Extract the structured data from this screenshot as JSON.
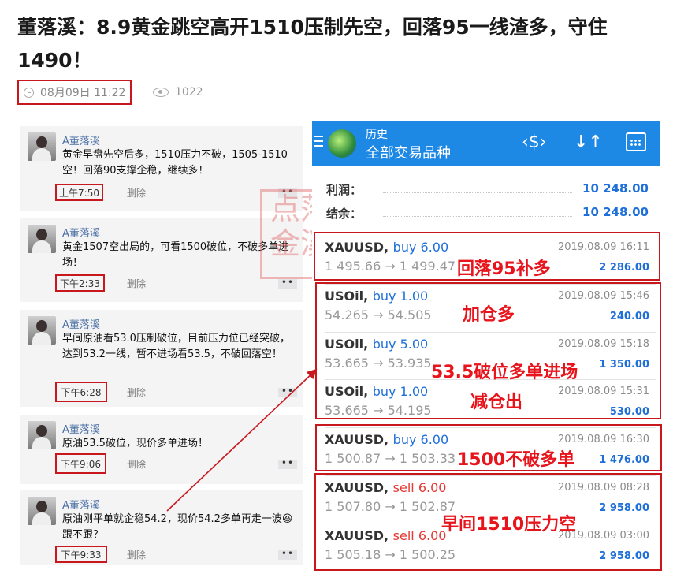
{
  "article": {
    "title": "董落溪：8.9黄金跳空高开1510压制先空，回落95一线渣多，守住1490！",
    "date": "08月09日 11:22",
    "views": "1022"
  },
  "chat": {
    "messages": [
      {
        "name": "A董落溪",
        "text": "黄金早盘先空后多，1510压力不破，1505-1510空！回落90支撑企稳，继续多！",
        "time": "上午7:50",
        "delete": "删除"
      },
      {
        "name": "A董落溪",
        "text": "黄金1507空出局的，可看1500破位，不破多单进场！",
        "time": "下午2:33",
        "delete": "删除"
      },
      {
        "name": "A董落溪",
        "text": "早间原油看53.0压制破位，目前压力位已经突破，达到53.2一线，暂不进场看53.5，不破回落空！",
        "time": "下午6:28",
        "delete": "删除"
      },
      {
        "name": "A董落溪",
        "text": "原油53.5破位，现价多单进场！",
        "time": "下午9:06",
        "delete": "删除"
      },
      {
        "name": "A董落溪",
        "text": "原油刚平单就企稳54.2，现价54.2多单再走一波😆跟不跟？",
        "time": "下午9:33",
        "delete": "删除"
      }
    ],
    "more_label": "••",
    "watermark": "点落金溪"
  },
  "app": {
    "title": "历史",
    "subtitle": "全部交易品种",
    "menu_icon": "menu-icon",
    "icons": [
      "currency-sort-icon",
      "sort-arrows-icon",
      "calendar-icon"
    ],
    "profit_label": "利润：",
    "profit_value": "10 248.00",
    "balance_label": "结余：",
    "balance_value": "10 248.00",
    "trades": [
      {
        "symbol": "XAUUSD,",
        "side": "buy 6.00",
        "side_type": "buy",
        "prices": "1 495.66 → 1 499.47",
        "datetime": "2019.08.09 16:11",
        "profit": "2 286.00"
      },
      {
        "symbol": "USOil,",
        "side": "buy 1.00",
        "side_type": "buy",
        "prices": "54.265 → 54.505",
        "datetime": "2019.08.09 15:46",
        "profit": "240.00"
      },
      {
        "symbol": "USOil,",
        "side": "buy 5.00",
        "side_type": "buy",
        "prices": "53.665 → 53.935",
        "datetime": "2019.08.09 15:18",
        "profit": "1 350.00"
      },
      {
        "symbol": "USOil,",
        "side": "buy 1.00",
        "side_type": "buy",
        "prices": "53.665 → 54.195",
        "datetime": "2019.08.09 15:31",
        "profit": "530.00"
      },
      {
        "symbol": "XAUUSD,",
        "side": "buy 6.00",
        "side_type": "buy",
        "prices": "1 500.87 → 1 503.33",
        "datetime": "2019.08.09 16:30",
        "profit": "1 476.00"
      },
      {
        "symbol": "XAUUSD,",
        "side": "sell 6.00",
        "side_type": "sell",
        "prices": "1 507.80 → 1 502.87",
        "datetime": "2019.08.09 08:28",
        "profit": "2 958.00"
      },
      {
        "symbol": "XAUUSD,",
        "side": "sell 6.00",
        "side_type": "sell",
        "prices": "1 505.18 → 1 500.25",
        "datetime": "2019.08.09 03:00",
        "profit": "2 958.00"
      }
    ]
  },
  "annotations": [
    "回落95补多",
    "加仓多",
    "53.5破位多单进场",
    "减仓出",
    "1500不破多单",
    "早间1510压力空"
  ],
  "colors": {
    "accent_red": "#c8181e",
    "note_red": "#e8141c",
    "app_blue": "#1e88e5",
    "value_blue": "#1e6fd9"
  }
}
